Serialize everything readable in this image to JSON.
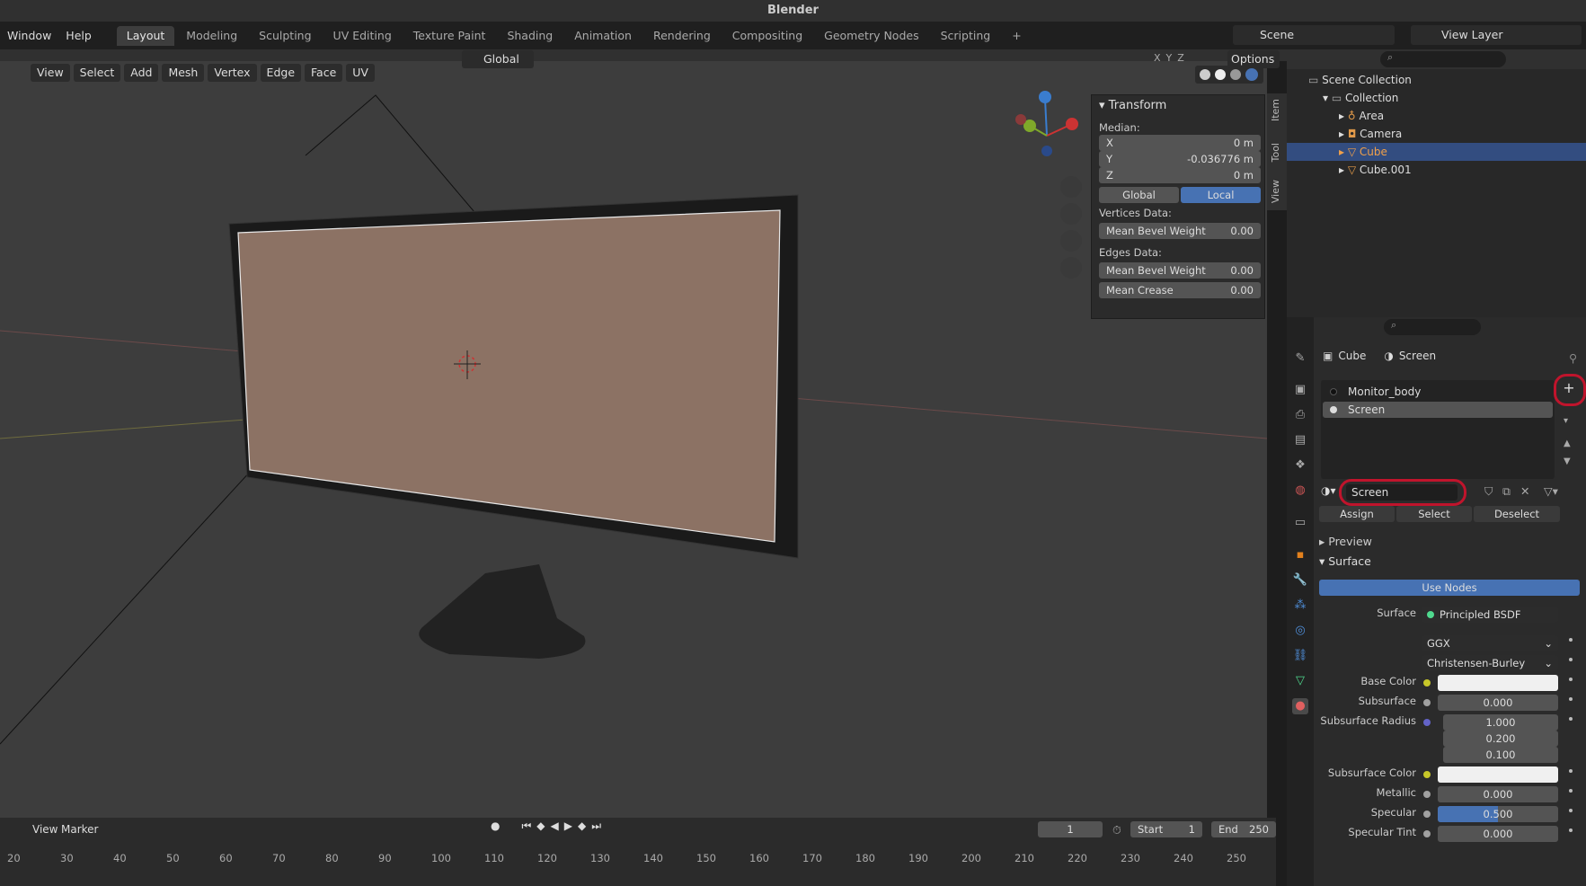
{
  "title": "Blender",
  "menu": [
    "Window",
    "Help"
  ],
  "workspaces": [
    "Layout",
    "Modeling",
    "Sculpting",
    "UV Editing",
    "Texture Paint",
    "Shading",
    "Animation",
    "Rendering",
    "Compositing",
    "Geometry Nodes",
    "Scripting",
    "+"
  ],
  "active_workspace": "Layout",
  "scene": "Scene",
  "view_layer": "View Layer",
  "viewport": {
    "orientation": "Global",
    "options_label": "Options",
    "axes": [
      "X",
      "Y",
      "Z"
    ],
    "menus": [
      "View",
      "Select",
      "Add",
      "Mesh",
      "Vertex",
      "Edge",
      "Face",
      "UV"
    ]
  },
  "npanel": {
    "section": "Transform",
    "median_label": "Median:",
    "x": {
      "label": "X",
      "value": "0 m"
    },
    "y": {
      "label": "Y",
      "value": "-0.036776 m"
    },
    "z": {
      "label": "Z",
      "value": "0 m"
    },
    "global": "Global",
    "local": "Local",
    "vertices_data": "Vertices Data:",
    "vert_bevel": {
      "label": "Mean Bevel Weight",
      "value": "0.00"
    },
    "edges_data": "Edges Data:",
    "edge_bevel": {
      "label": "Mean Bevel Weight",
      "value": "0.00"
    },
    "edge_crease": {
      "label": "Mean Crease",
      "value": "0.00"
    },
    "tabs": [
      "Item",
      "Tool",
      "View"
    ]
  },
  "outliner": {
    "root": "Scene Collection",
    "collection": "Collection",
    "items": [
      "Area",
      "Camera",
      "Cube",
      "Cube.001"
    ],
    "selected": "Cube"
  },
  "properties": {
    "breadcrumb_object": "Cube",
    "breadcrumb_material": "Screen",
    "slots": [
      "Monitor_body",
      "Screen"
    ],
    "material_name": "Screen",
    "assign": "Assign",
    "select": "Select",
    "deselect": "Deselect",
    "preview": "Preview",
    "surface_section": "Surface",
    "use_nodes": "Use Nodes",
    "surface_label": "Surface",
    "surface_value": "Principled BSDF",
    "distribution": "GGX",
    "subsurface_method": "Christensen-Burley",
    "base_color_label": "Base Color",
    "subsurface_label": "Subsurface",
    "subsurface_value": "0.000",
    "subsurface_radius_label": "Subsurface Radius",
    "subsurface_radius": [
      "1.000",
      "0.200",
      "0.100"
    ],
    "subsurface_color_label": "Subsurface Color",
    "metallic_label": "Metallic",
    "metallic_value": "0.000",
    "specular_label": "Specular",
    "specular_value": "0.500",
    "specular_fill": 0.5,
    "specular_tint_label": "Specular Tint",
    "specular_tint_value": "0.000"
  },
  "timeline": {
    "view": "View",
    "marker": "Marker",
    "current_frame": "1",
    "start_label": "Start",
    "start": "1",
    "end_label": "End",
    "end": "250",
    "ticks": [
      "20",
      "30",
      "40",
      "50",
      "60",
      "70",
      "80",
      "90",
      "100",
      "110",
      "120",
      "130",
      "140",
      "150",
      "160",
      "170",
      "180",
      "190",
      "200",
      "210",
      "220",
      "230",
      "240",
      "250"
    ]
  },
  "colors": {
    "accent": "#4772b3",
    "selected_row": "#334d80",
    "highlight_ring": "#c0142c"
  }
}
